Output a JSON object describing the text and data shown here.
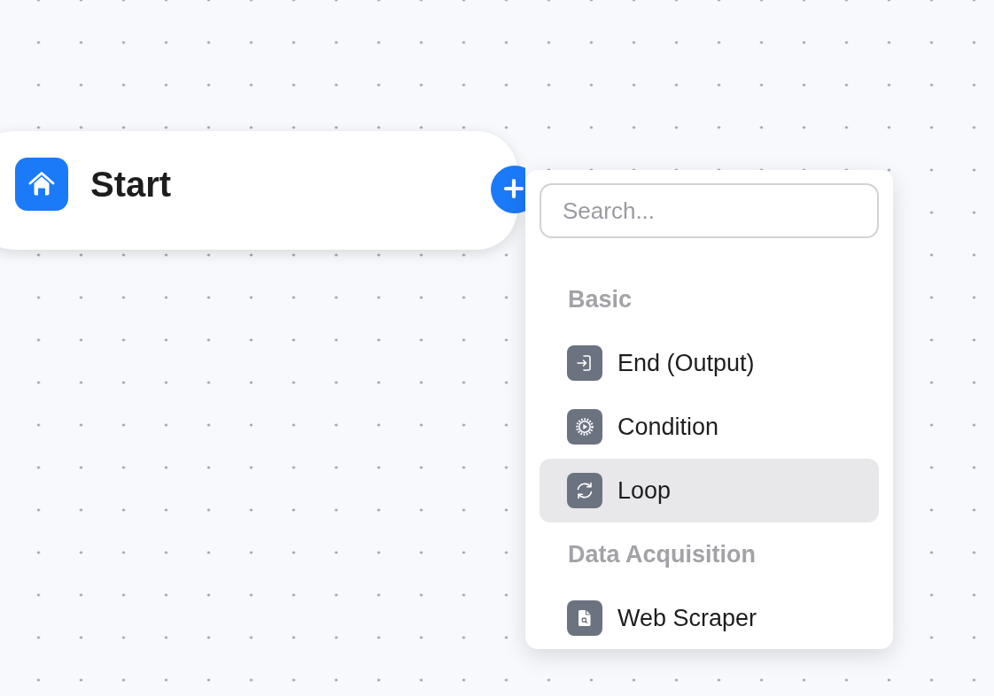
{
  "start_node": {
    "title": "Start"
  },
  "add_menu": {
    "search": {
      "placeholder": "Search..."
    },
    "groups": [
      {
        "title": "Basic",
        "items": [
          {
            "label": "End (Output)",
            "kind": "output",
            "selected": false
          },
          {
            "label": "Condition",
            "kind": "condition",
            "selected": false
          },
          {
            "label": "Loop",
            "kind": "loop",
            "selected": true
          }
        ]
      },
      {
        "title": "Data Acquisition",
        "items": [
          {
            "label": "Web Scraper",
            "kind": "scraper",
            "selected": false
          }
        ]
      }
    ]
  }
}
